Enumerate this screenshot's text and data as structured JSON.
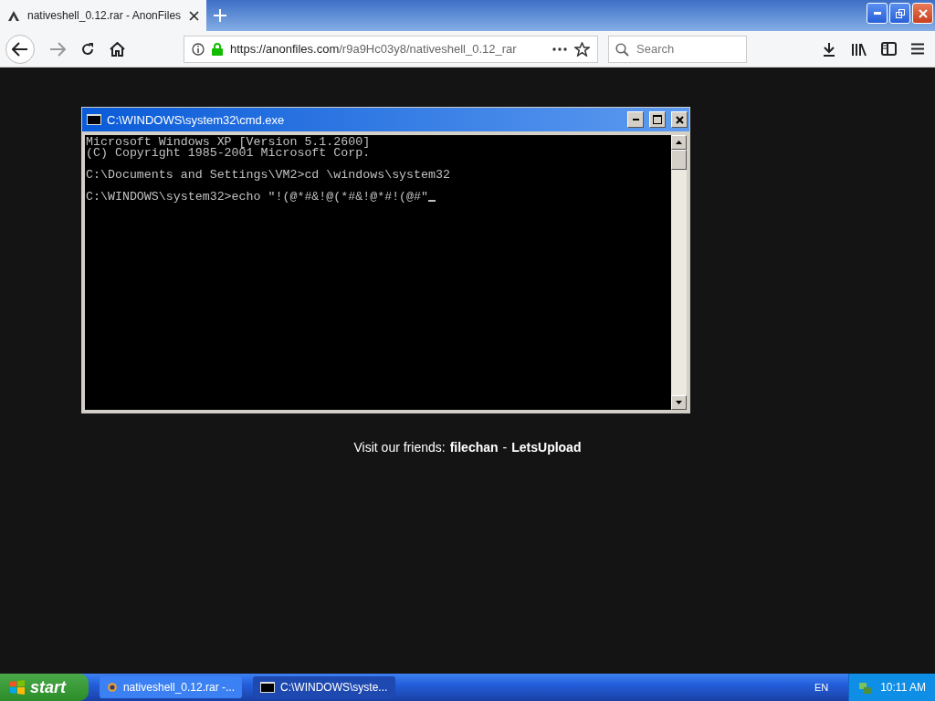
{
  "browser": {
    "tab": {
      "title": "nativeshell_0.12.rar - AnonFiles",
      "selected": true
    },
    "url": {
      "host": "https://anonfiles.com",
      "path": "/r9a9Hc03y8/nativeshell_0.12_rar"
    },
    "search": {
      "placeholder": "Search"
    }
  },
  "page": {
    "friends": {
      "label": "Visit our friends:",
      "links": [
        "filechan",
        "LetsUpload"
      ],
      "separator": "-"
    }
  },
  "console_window": {
    "title": "C:\\WINDOWS\\system32\\cmd.exe",
    "paragraphs": [
      [
        "Microsoft Windows XP [Version 5.1.2600]",
        "(C) Copyright 1985-2001 Microsoft Corp."
      ],
      [
        "C:\\Documents and Settings\\VM2>cd \\windows\\system32"
      ],
      [
        "C:\\WINDOWS\\system32>echo \"!(@*#&!@(*#&!@*#!(@#\""
      ]
    ],
    "cursor": true
  },
  "taskbar": {
    "start": "start",
    "tasks": [
      {
        "label": "nativeshell_0.12.rar -...",
        "kind": "browser",
        "selected": false
      },
      {
        "label": "C:\\WINDOWS\\syste...",
        "kind": "console",
        "selected": true
      }
    ],
    "language": "EN",
    "clock": "10:11 AM"
  }
}
